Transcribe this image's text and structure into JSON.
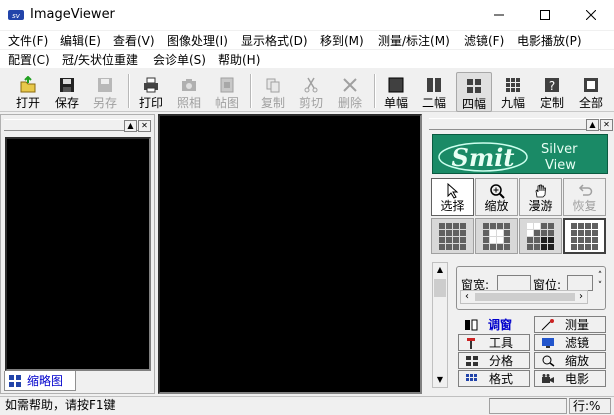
{
  "window": {
    "title": "ImageViewer",
    "icon": "app-logo-icon",
    "controls": [
      "minimize-icon",
      "maximize-icon",
      "close-icon"
    ]
  },
  "menu": {
    "row1": [
      "文件(F)",
      "编辑(E)",
      "查看(V)",
      "图像处理(I)",
      "显示格式(D)",
      "移到(M)",
      "测量/标注(M)",
      "滤镜(F)",
      "电影播放(P)"
    ],
    "row2": [
      "配置(C)",
      "冠/矢状位重建",
      "会诊单(S)",
      "帮助(H)"
    ]
  },
  "toolbar": {
    "open": "打开",
    "save": "保存",
    "save_as": "另存",
    "print": "打印",
    "photo": "照相",
    "paste_image": "帖图",
    "copy": "复制",
    "cut": "剪切",
    "delete": "删除",
    "layout_1": "单幅",
    "layout_2": "二幅",
    "layout_4": "四幅",
    "layout_9": "九幅",
    "layout_custom": "定制",
    "layout_all": "全部"
  },
  "left_panel": {
    "tab_label": "缩略图"
  },
  "right_panel": {
    "logo_text": "Smit",
    "logo_sub1": "Silver",
    "logo_sub2": "View",
    "modes": {
      "select": "选择",
      "zoom": "缩放",
      "pan": "漫游",
      "restore": "恢复"
    },
    "window_width_label": "窗宽:",
    "window_level_label": "窗位:",
    "functions": {
      "window": "调窗",
      "measure": "测量",
      "tools": "工具",
      "filter": "滤镜",
      "split": "分格",
      "zoom": "缩放",
      "format": "格式",
      "movie": "电影"
    }
  },
  "status": {
    "help": "如需帮助，请按F1键",
    "position": "行:%"
  }
}
